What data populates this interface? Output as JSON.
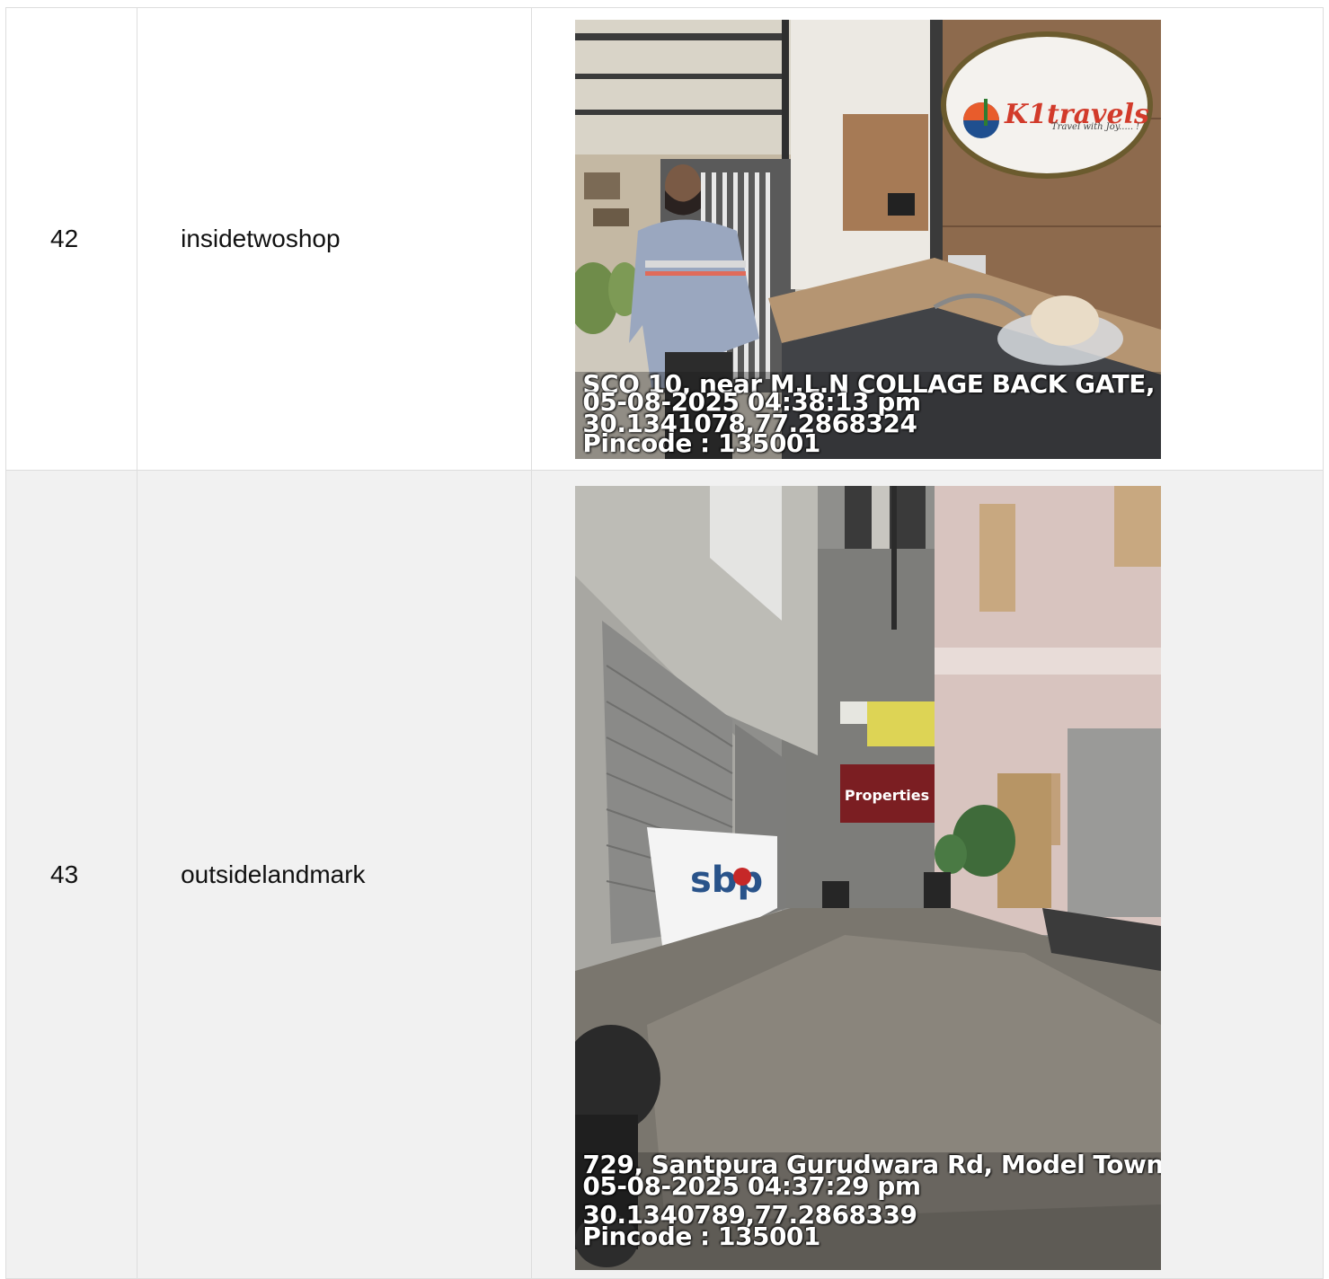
{
  "rows": [
    {
      "number": "42",
      "tag": "insidetwoshop",
      "photo": {
        "subject": "shop-interior-with-person-and-sign",
        "sign_text": "K1travels",
        "sign_subtext": "Travel with Joy..... !",
        "stamp_lines": [
          "SCO 10, near M.L.N COLLAGE BACK GATE, ..",
          "05-08-2025 04:38:13 pm",
          "30.1341078,77.2868324",
          "Pincode : 135001"
        ]
      }
    },
    {
      "number": "43",
      "tag": "outsidelandmark",
      "photo": {
        "subject": "alley-with-shutters-and-motorbikes",
        "sign_text": "Properties",
        "board_text": "sbp",
        "stamp_lines": [
          "729, Santpura Gurudwara Rd, Model Town, ..",
          "05-08-2025 04:37:29 pm",
          "30.1340789,77.2868339",
          "Pincode : 135001"
        ]
      }
    }
  ]
}
